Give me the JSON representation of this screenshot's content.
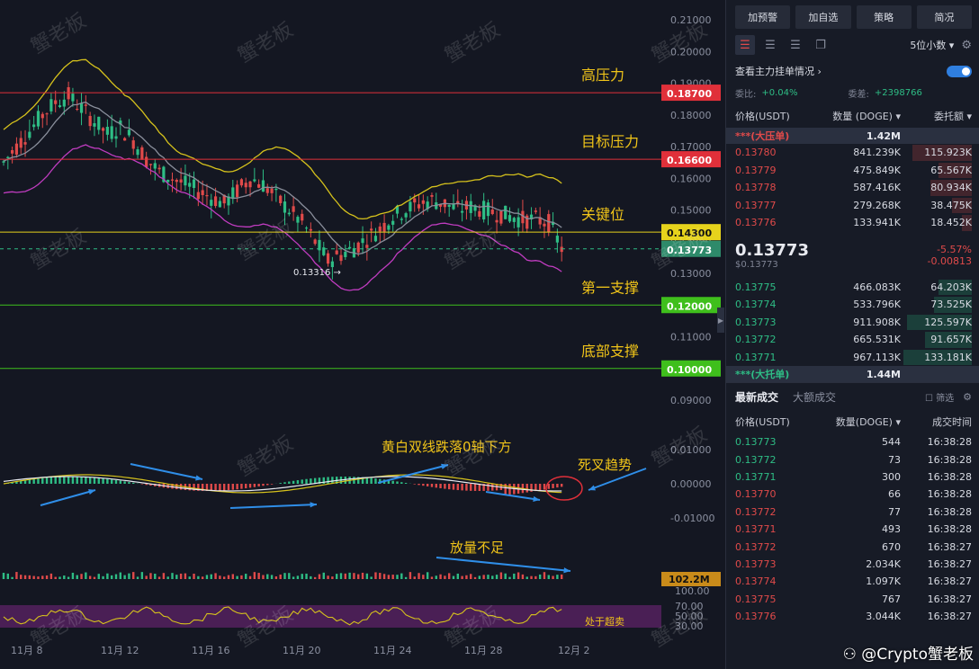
{
  "chart_data": {
    "type": "candlestick",
    "symbol": "DOGE/USDT",
    "price_axis": {
      "ticks": [
        "0.21000",
        "0.20000",
        "0.19000",
        "0.18000",
        "0.17000",
        "0.16000",
        "0.15000",
        "0.14000",
        "0.13000",
        "0.12000",
        "0.11000",
        "0.10000",
        "0.09000"
      ],
      "range": [
        0.085,
        0.212
      ]
    },
    "date_axis": [
      "11月 8",
      "11月 12",
      "11月 16",
      "11月 20",
      "11月 24",
      "11月 28",
      "12月 2"
    ],
    "price_path": [
      0.165,
      0.17,
      0.175,
      0.18,
      0.184,
      0.186,
      0.182,
      0.178,
      0.174,
      0.176,
      0.172,
      0.166,
      0.162,
      0.16,
      0.158,
      0.156,
      0.154,
      0.152,
      0.156,
      0.16,
      0.158,
      0.154,
      0.15,
      0.146,
      0.14,
      0.134,
      0.136,
      0.138,
      0.141,
      0.144,
      0.148,
      0.15,
      0.152,
      0.153,
      0.152,
      0.15,
      0.151,
      0.15,
      0.149,
      0.148,
      0.147,
      0.147,
      0.146,
      0.138
    ],
    "levels": [
      {
        "label": "高压力",
        "value": "0.18700",
        "color": "#e0303a"
      },
      {
        "label": "目标压力",
        "value": "0.16600",
        "color": "#e0303a"
      },
      {
        "label": "关键位",
        "value": "0.14300",
        "color": "#e6d31c"
      },
      {
        "label": "第一支撑",
        "value": "0.12000",
        "color": "#3fbf1c"
      },
      {
        "label": "底部支撑",
        "value": "0.10000",
        "color": "#3fbf1c"
      }
    ],
    "current_price": "0.13773",
    "low_marker": "0.13316",
    "macd_axis": [
      "0.01000",
      "0.00000",
      "-0.01000"
    ],
    "volume_value": "102.2M",
    "rsi_axis": [
      "100.00",
      "70.00",
      "50.00",
      "30.00"
    ],
    "annotations": [
      "黄白双线跌落0轴下方",
      "死叉趋势",
      "放量不足",
      "处于超卖"
    ],
    "watermark_repeat": "蟹老板"
  },
  "toolbar": {
    "b1": "加预警",
    "b2": "加自选",
    "b3": "策略",
    "b4": "简况"
  },
  "depth": {
    "decimals": "5位小数",
    "main_orders": "查看主力挂单情况",
    "ratio_label": "委比:",
    "ratio_value": "+0.04%",
    "diff_label": "委差:",
    "diff_value": "+2398766",
    "col_price": "价格(USDT)",
    "col_qty": "数量 (DOGE)",
    "col_total": "委托额",
    "ask_big": "***(大压单)",
    "ask_big_qty": "1.42M",
    "asks": [
      {
        "p": "0.13780",
        "q": "841.239K",
        "t": "115.923K"
      },
      {
        "p": "0.13779",
        "q": "475.849K",
        "t": "65.567K"
      },
      {
        "p": "0.13778",
        "q": "587.416K",
        "t": "80.934K"
      },
      {
        "p": "0.13777",
        "q": "279.268K",
        "t": "38.475K"
      },
      {
        "p": "0.13776",
        "q": "133.941K",
        "t": "18.452K"
      }
    ],
    "last_price": "0.13773",
    "last_sub": "$0.13773",
    "change_pct": "-5.57%",
    "change_abs": "-0.00813",
    "bids": [
      {
        "p": "0.13775",
        "q": "466.083K",
        "t": "64.203K"
      },
      {
        "p": "0.13774",
        "q": "533.796K",
        "t": "73.525K"
      },
      {
        "p": "0.13773",
        "q": "911.908K",
        "t": "125.597K"
      },
      {
        "p": "0.13772",
        "q": "665.531K",
        "t": "91.657K"
      },
      {
        "p": "0.13771",
        "q": "967.113K",
        "t": "133.181K"
      }
    ],
    "bid_big": "***(大托单)",
    "bid_big_qty": "1.44M"
  },
  "trades": {
    "tab1": "最新成交",
    "tab2": "大额成交",
    "tab3": "筛选",
    "col_price": "价格(USDT)",
    "col_qty": "数量(DOGE)",
    "col_time": "成交时间",
    "rows": [
      {
        "p": "0.13773",
        "q": "544",
        "t": "16:38:28",
        "side": "buy"
      },
      {
        "p": "0.13772",
        "q": "73",
        "t": "16:38:28",
        "side": "buy"
      },
      {
        "p": "0.13771",
        "q": "300",
        "t": "16:38:28",
        "side": "buy"
      },
      {
        "p": "0.13770",
        "q": "66",
        "t": "16:38:28",
        "side": "sell"
      },
      {
        "p": "0.13772",
        "q": "77",
        "t": "16:38:28",
        "side": "sell"
      },
      {
        "p": "0.13771",
        "q": "493",
        "t": "16:38:28",
        "side": "sell"
      },
      {
        "p": "0.13772",
        "q": "670",
        "t": "16:38:27",
        "side": "sell"
      },
      {
        "p": "0.13773",
        "q": "2.034K",
        "t": "16:38:27",
        "side": "sell"
      },
      {
        "p": "0.13774",
        "q": "1.097K",
        "t": "16:38:27",
        "side": "sell"
      },
      {
        "p": "0.13775",
        "q": "767",
        "t": "16:38:27",
        "side": "sell"
      },
      {
        "p": "0.13776",
        "q": "3.044K",
        "t": "16:38:27",
        "side": "sell"
      }
    ]
  },
  "watermark": "Crypto蟹老板"
}
